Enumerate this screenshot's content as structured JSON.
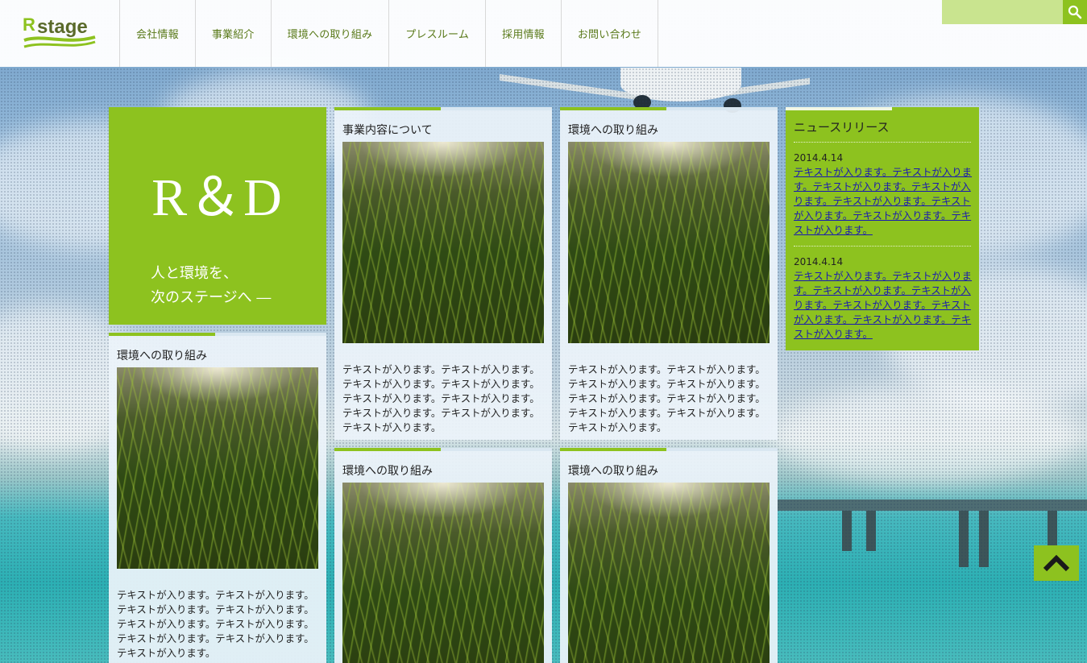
{
  "brand": {
    "logo_text": "R stage"
  },
  "nav": {
    "items": [
      {
        "label": "会社情報"
      },
      {
        "label": "事業紹介"
      },
      {
        "label": "環境への取り組み"
      },
      {
        "label": "プレスルーム"
      },
      {
        "label": "採用情報"
      },
      {
        "label": "お問い合わせ"
      }
    ]
  },
  "search": {
    "placeholder": "",
    "icon": "search-icon"
  },
  "hero": {
    "title": "R＆D",
    "tagline_line1": "人と環境を、",
    "tagline_line2": "次のステージへ ―"
  },
  "cards": [
    {
      "title": "環境への取り組み",
      "text": "テキストが入ります。テキストが入ります。テキストが入ります。テキストが入ります。テキストが入ります。テキストが入ります。テキストが入ります。テキストが入ります。テキストが入ります。"
    },
    {
      "title": "事業内容について",
      "text": "テキストが入ります。テキストが入ります。テキストが入ります。テキストが入ります。テキストが入ります。テキストが入ります。テキストが入ります。テキストが入ります。テキストが入ります。"
    },
    {
      "title": "環境への取り組み",
      "text": "テキストが入ります。テキストが入ります。テキストが入ります。テキストが入ります。テキストが入ります。テキストが入ります。テキストが入ります。テキストが入ります。テキストが入ります。"
    },
    {
      "title": "環境への取り組み",
      "text": ""
    },
    {
      "title": "環境への取り組み",
      "text": ""
    }
  ],
  "news": {
    "title": "ニュースリリース",
    "items": [
      {
        "date": "2014.4.14",
        "text": "テキストが入ります。テキストが入ります。テキストが入ります。テキストが入ります。テキストが入ります。テキストが入ります。テキストが入ります。テキストが入ります。"
      },
      {
        "date": "2014.4.14",
        "text": "テキストが入ります。テキストが入ります。テキストが入ります。テキストが入ります。テキストが入ります。テキストが入ります。テキストが入ります。テキストが入ります。"
      }
    ]
  },
  "colors": {
    "accent": "#8dc21f",
    "search_bg": "#c9e48f",
    "link": "#1a1ab0"
  },
  "pagetop": {
    "icon": "chevron-up-icon"
  }
}
